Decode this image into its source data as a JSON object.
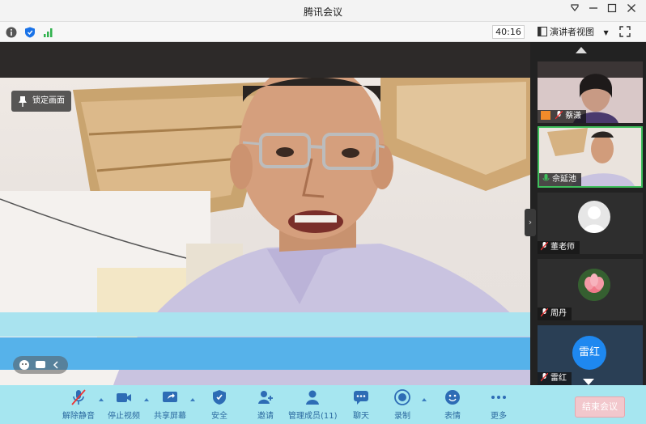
{
  "window": {
    "title": "腾讯会议"
  },
  "infobar": {
    "timer": "40:16",
    "view_mode": "演讲者视图"
  },
  "main": {
    "lock_label": "锁定画面"
  },
  "participants": [
    {
      "name": "蔡潇"
    },
    {
      "name": "佘延池"
    },
    {
      "name": "董老师"
    },
    {
      "name": "周丹"
    },
    {
      "name": "雷红",
      "avatar_text": "雷红"
    }
  ],
  "toolbar": {
    "items": [
      {
        "label": "解除静音"
      },
      {
        "label": "停止视频"
      },
      {
        "label": "共享屏幕"
      },
      {
        "label": "安全"
      },
      {
        "label": "邀请"
      },
      {
        "label": "管理成员(11)"
      },
      {
        "label": "聊天"
      },
      {
        "label": "录制"
      },
      {
        "label": "表情"
      },
      {
        "label": "更多"
      }
    ],
    "end_label": "结束会议"
  },
  "colors": {
    "accent": "#1e88f0",
    "toolbar_bg": "#a6e6f0",
    "active_border": "#3fbf5c",
    "end_button": "#f2c7cc"
  }
}
